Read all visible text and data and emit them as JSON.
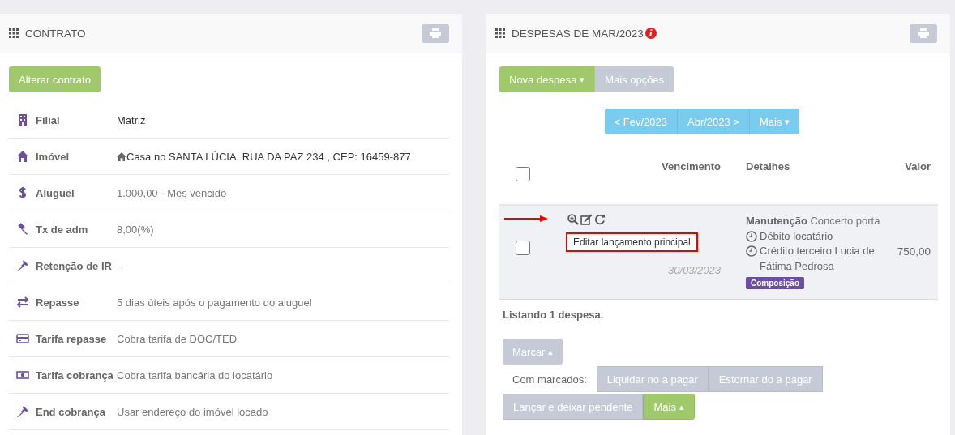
{
  "contract_panel": {
    "title": "CONTRATO",
    "action_button": "Alterar contrato",
    "rows": [
      {
        "kind": "building",
        "label": "Filial",
        "value": "Matriz",
        "emphasis": true,
        "value_icon": false
      },
      {
        "kind": "home",
        "label": "Imóvel",
        "value": "Casa no SANTA LÚCIA, RUA DA PAZ 234 , CEP: 16459-877",
        "emphasis": true,
        "value_icon": true
      },
      {
        "kind": "dollar",
        "label": "Aluguel",
        "value": "1.000,00 - Mês vencido",
        "emphasis": false,
        "value_icon": false
      },
      {
        "kind": "gavel",
        "label": "Tx de adm",
        "value": "8,00(%)",
        "emphasis": false,
        "value_icon": false
      },
      {
        "kind": "pin",
        "label": "Retenção de IR",
        "value": "--",
        "emphasis": false,
        "value_icon": false
      },
      {
        "kind": "transfer",
        "label": "Repasse",
        "value": "5 dias úteis após o pagamento do aluguel",
        "emphasis": false,
        "value_icon": false
      },
      {
        "kind": "card",
        "label": "Tarifa repasse",
        "value": "Cobra tarifa de DOC/TED",
        "emphasis": false,
        "value_icon": false
      },
      {
        "kind": "money",
        "label": "Tarifa cobrança",
        "value": "Cobra tarifa bancária do locatário",
        "emphasis": false,
        "value_icon": false
      },
      {
        "kind": "pin",
        "label": "End cobrança",
        "value": "Usar endereço do imóvel locado",
        "emphasis": false,
        "value_icon": false
      }
    ]
  },
  "expenses_panel": {
    "title": "DESPESAS DE MAR/2023",
    "info_badge": "i",
    "top_buttons": [
      {
        "label": "Nova despesa",
        "kind": "primary",
        "caret": "▾"
      },
      {
        "label": "Mais opções",
        "kind": "muted"
      }
    ],
    "nav_buttons": [
      {
        "label": "< Fev/2023"
      },
      {
        "label": "Abr/2023 >"
      },
      {
        "label": "Mais",
        "caret": "▾"
      }
    ],
    "table": {
      "columns": [
        "Vencimento",
        "Detalhes",
        "Valor"
      ],
      "select_all_checked": false,
      "rows": [
        {
          "checked": false,
          "due_date": "30/03/2023",
          "category": "Manutenção",
          "description": "Concerto porta",
          "lines": [
            "Débito locatário",
            "Crédito terceiro Lucia de Fátima Pedrosa"
          ],
          "tag": "Composição",
          "value": "750,00",
          "tooltip": "Editar lançamento principal"
        }
      ]
    },
    "summary": "Listando 1 despesa.",
    "mark_button": {
      "label": "Marcar",
      "caret": "▴"
    },
    "bulk_label": "Com marcados:",
    "bulk_buttons": [
      {
        "label": "Liquidar no a pagar",
        "kind": "muted"
      },
      {
        "label": "Estornar do a pagar",
        "kind": "muted"
      },
      {
        "label": "Lançar e deixar pendente",
        "kind": "muted"
      },
      {
        "label": "Mais",
        "kind": "primary",
        "caret": "▴"
      }
    ]
  }
}
